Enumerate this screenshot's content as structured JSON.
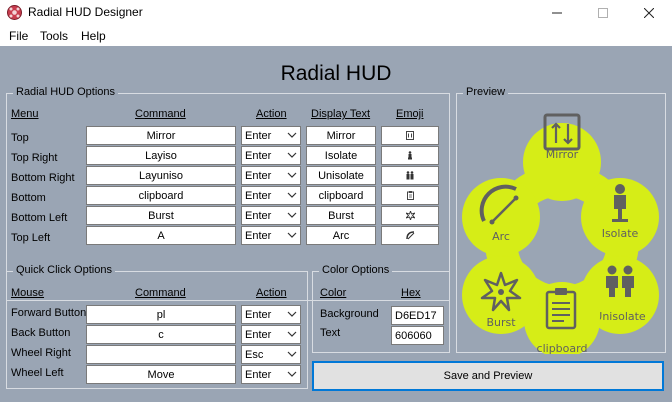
{
  "window": {
    "title": "Radial HUD Designer"
  },
  "menu": [
    "File",
    "Tools",
    "Help"
  ],
  "app_title": "Radial HUD",
  "hud_options": {
    "legend": "Radial HUD Options",
    "headers": {
      "menu": "Menu",
      "command": "Command",
      "action": "Action",
      "display": "Display Text",
      "emoji": "Emoji"
    },
    "rows": [
      {
        "menu": "Top",
        "command": "Mirror",
        "action": "Enter",
        "display": "Mirror",
        "emoji": "mirror-icon"
      },
      {
        "menu": "Top Right",
        "command": "Layiso",
        "action": "Enter",
        "display": "Isolate",
        "emoji": "isolate-icon"
      },
      {
        "menu": "Bottom Right",
        "command": "Layuniso",
        "action": "Enter",
        "display": "Unisolate",
        "emoji": "unisolate-icon"
      },
      {
        "menu": "Bottom",
        "command": "clipboard",
        "action": "Enter",
        "display": "clipboard",
        "emoji": "clipboard-icon"
      },
      {
        "menu": "Bottom Left",
        "command": "Burst",
        "action": "Enter",
        "display": "Burst",
        "emoji": "burst-icon"
      },
      {
        "menu": "Top Left",
        "command": "A",
        "action": "Enter",
        "display": "Arc",
        "emoji": "arc-icon"
      }
    ]
  },
  "quick_click": {
    "legend": "Quick Click Options",
    "headers": {
      "mouse": "Mouse",
      "command": "Command",
      "action": "Action"
    },
    "rows": [
      {
        "mouse": "Forward Button",
        "command": "pl",
        "action": "Enter"
      },
      {
        "mouse": "Back Button",
        "command": "c",
        "action": "Enter"
      },
      {
        "mouse": "Wheel Right",
        "command": "",
        "action": "Esc"
      },
      {
        "mouse": "Wheel Left",
        "command": "Move",
        "action": "Enter"
      }
    ]
  },
  "color_options": {
    "legend": "Color Options",
    "headers": {
      "color": "Color",
      "hex": "Hex"
    },
    "rows": [
      {
        "label": "Background",
        "hex": "D6ED17"
      },
      {
        "label": "Text",
        "hex": "606060"
      }
    ]
  },
  "preview": {
    "legend": "Preview",
    "items": [
      "Mirror",
      "Isolate",
      "Unisolate",
      "clipboard",
      "Burst",
      "Arc"
    ],
    "background_color": "#D6ED17",
    "text_color": "#606060"
  },
  "save_button": "Save and Preview"
}
